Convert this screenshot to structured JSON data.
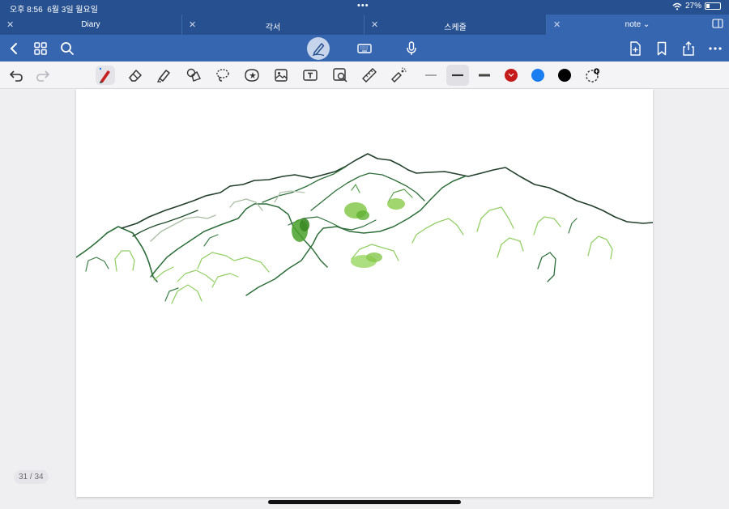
{
  "status_bar": {
    "time": "오후 8:56",
    "date": "6월 3일 월요일",
    "battery": "27%",
    "battery_level": 0.27
  },
  "tabs": [
    {
      "label": "Diary",
      "active": false
    },
    {
      "label": "각서",
      "active": false
    },
    {
      "label": "스케줄",
      "active": false
    },
    {
      "label": "note",
      "active": true
    }
  ],
  "icons": {
    "nav": [
      "back-icon",
      "grid-icon",
      "search-icon",
      "pen-mode-icon",
      "keyboard-icon",
      "microphone-icon",
      "add-page-icon",
      "bookmark-icon",
      "share-icon",
      "more-icon"
    ],
    "toolbar": [
      "undo-icon",
      "redo-icon",
      "pen-tool-icon",
      "eraser-icon",
      "highlighter-icon",
      "shape-icon",
      "lasso-icon",
      "sticker-icon",
      "image-icon",
      "text-box-icon",
      "zoom-box-icon",
      "ruler-icon",
      "laser-pointer-icon"
    ]
  },
  "colors": {
    "accent": "#26508f",
    "swatch_red": "#c41a1a",
    "swatch_blue": "#1a7ef0",
    "swatch_black": "#000000"
  },
  "page_counter": "31 / 34"
}
